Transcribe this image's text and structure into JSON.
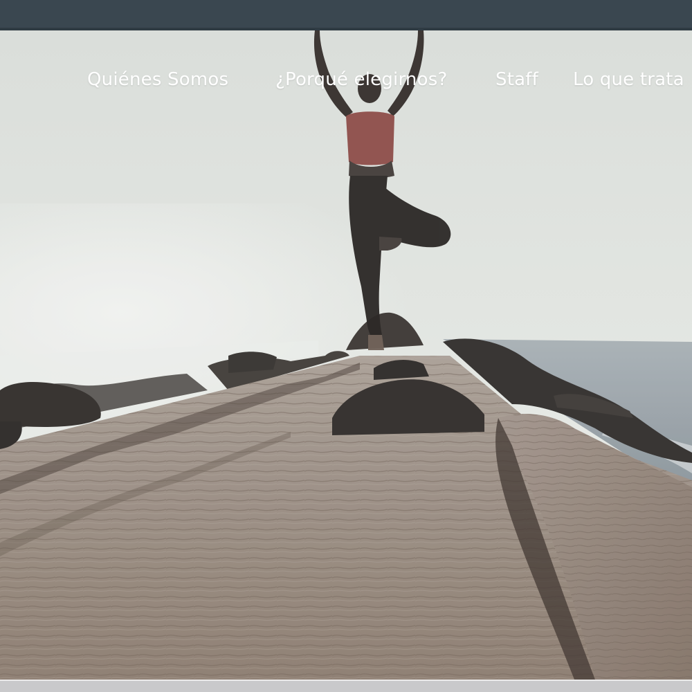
{
  "nav": {
    "items": [
      {
        "label": "Quiénes Somos"
      },
      {
        "label": "¿Porqué elegirnos?"
      },
      {
        "label": "Staff"
      },
      {
        "label": "Lo que trata"
      }
    ]
  },
  "hero": {
    "image": "yoga-tree-pose-on-pier-photo"
  },
  "colors": {
    "topbar": "#3a4750",
    "nav_text": "#ffffff",
    "sky": "#dfe3e1",
    "pier": "#8a7d72",
    "bottombar": "#c9c9cb"
  }
}
